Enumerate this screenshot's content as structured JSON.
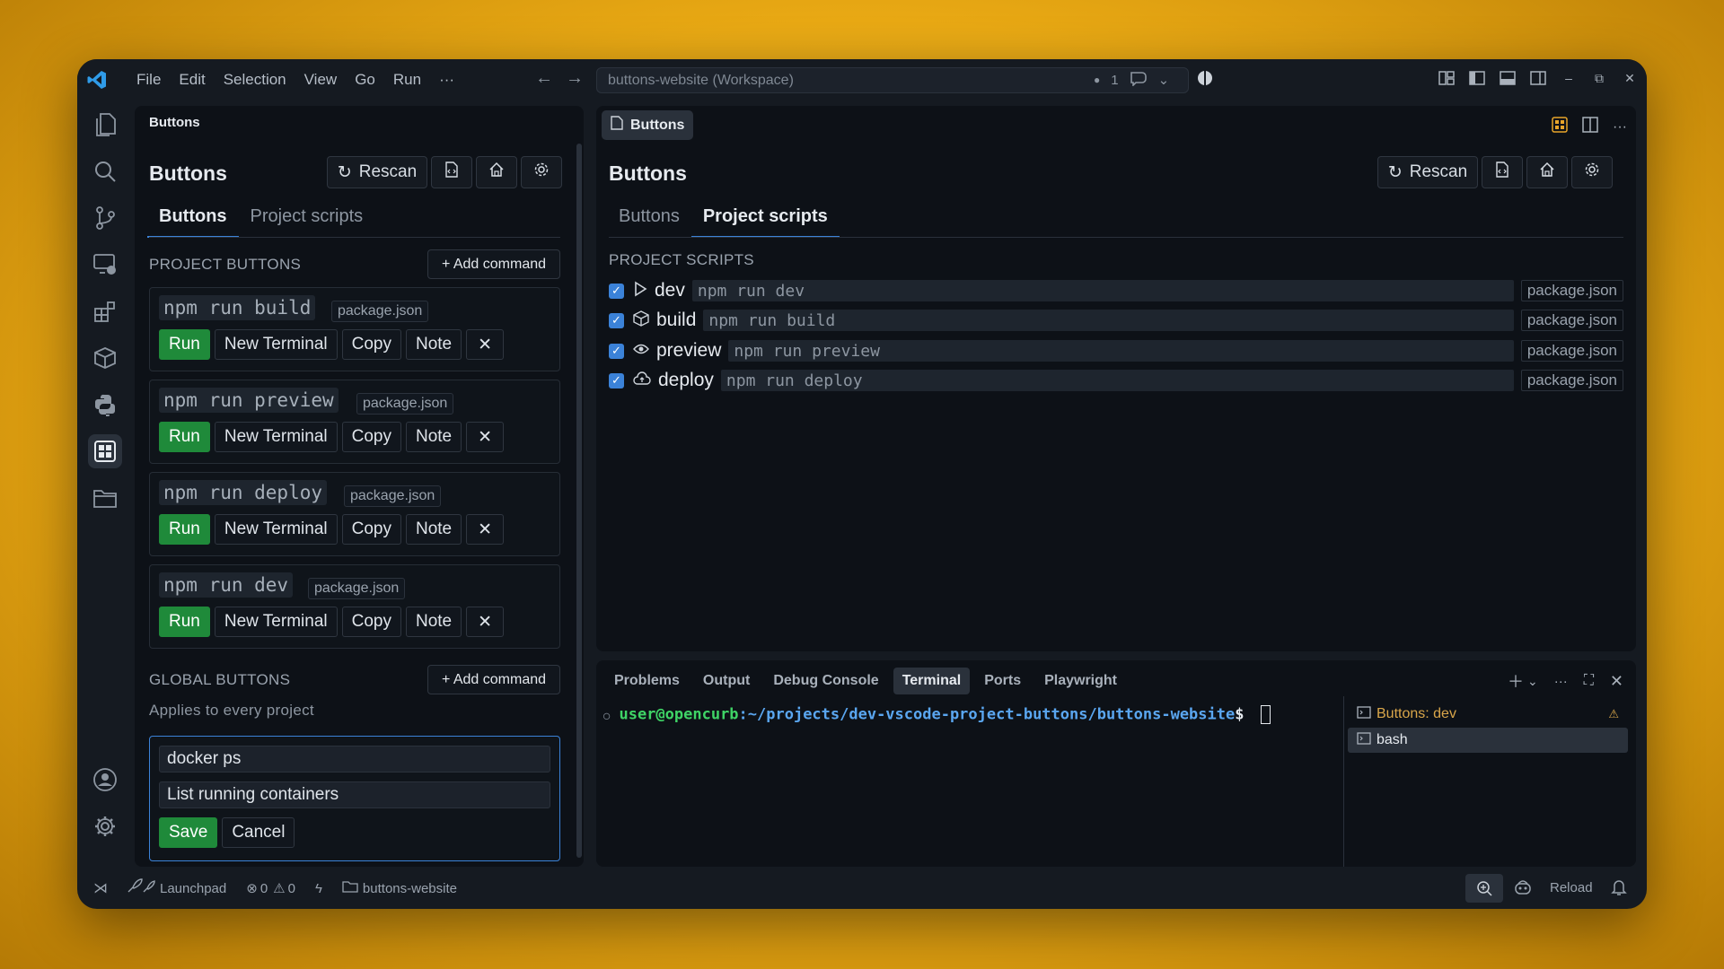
{
  "titlebar": {
    "menu": [
      "File",
      "Edit",
      "Selection",
      "View",
      "Go",
      "Run",
      "···"
    ],
    "workspace": "buttons-website (Workspace)",
    "notif_count": "1"
  },
  "sidebar": {
    "header": "Buttons",
    "title": "Buttons",
    "rescan_label": "Rescan",
    "tabs": [
      "Buttons",
      "Project scripts"
    ],
    "project_section": "PROJECT BUTTONS",
    "add_command": "+ Add command",
    "items": [
      {
        "cmd": "npm run build",
        "src": "package.json"
      },
      {
        "cmd": "npm run preview",
        "src": "package.json"
      },
      {
        "cmd": "npm run deploy",
        "src": "package.json"
      },
      {
        "cmd": "npm run dev",
        "src": "package.json"
      }
    ],
    "row_buttons": {
      "run": "Run",
      "new_terminal": "New Terminal",
      "copy": "Copy",
      "note": "Note",
      "remove": "✕"
    },
    "global_section": "GLOBAL BUTTONS",
    "global_hint": "Applies to every project",
    "form": {
      "command_value": "docker ps",
      "note_value": "List running containers",
      "save": "Save",
      "cancel": "Cancel"
    }
  },
  "editor": {
    "tab_label": "Buttons",
    "title": "Buttons",
    "rescan_label": "Rescan",
    "tabs": [
      "Buttons",
      "Project scripts"
    ],
    "section": "PROJECT SCRIPTS",
    "scripts": [
      {
        "name": "dev",
        "cmd": "npm run dev",
        "src": "package.json",
        "icon": "play-icon"
      },
      {
        "name": "build",
        "cmd": "npm run build",
        "src": "package.json",
        "icon": "package-icon"
      },
      {
        "name": "preview",
        "cmd": "npm run preview",
        "src": "package.json",
        "icon": "eye-icon"
      },
      {
        "name": "deploy",
        "cmd": "npm run deploy",
        "src": "package.json",
        "icon": "cloud-upload-icon"
      }
    ]
  },
  "panel": {
    "tabs": [
      "Problems",
      "Output",
      "Debug Console",
      "Terminal",
      "Ports",
      "Playwright"
    ],
    "prompt_user": "user@opencurb",
    "prompt_path": ":~/projects/dev-vscode-project-buttons/buttons-website",
    "prompt_symbol": "$",
    "terminals": [
      "Buttons: dev",
      "bash"
    ]
  },
  "statusbar": {
    "launchpad": "Launchpad",
    "errors": "0",
    "warnings": "0",
    "folder": "buttons-website",
    "reload": "Reload"
  },
  "colors": {
    "accent": "#3b82d8",
    "run_green": "#1f8a3a",
    "prompt_green": "#3fd466",
    "prompt_blue": "#5aa6f0"
  }
}
